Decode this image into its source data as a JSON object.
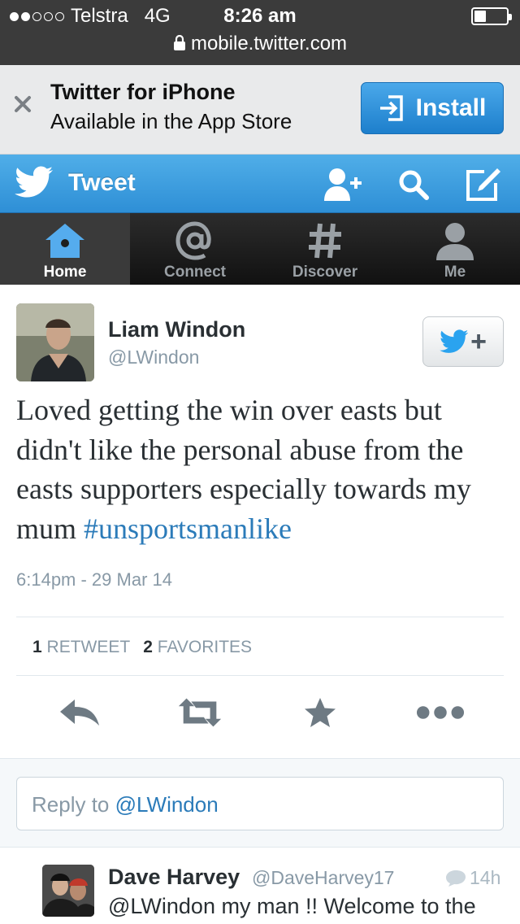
{
  "status_bar": {
    "carrier": "Telstra",
    "network": "4G",
    "time": "8:26 am",
    "signal_bars": 2,
    "url": "mobile.twitter.com"
  },
  "app_banner": {
    "title": "Twitter for iPhone",
    "subtitle": "Available in the App Store",
    "install_label": "Install"
  },
  "header": {
    "title": "Tweet",
    "icons": [
      "add-user-icon",
      "search-icon",
      "compose-icon"
    ]
  },
  "tabs": [
    {
      "label": "Home",
      "icon": "home-icon",
      "active": true
    },
    {
      "label": "Connect",
      "icon": "at-icon",
      "active": false
    },
    {
      "label": "Discover",
      "icon": "hashtag-icon",
      "active": false
    },
    {
      "label": "Me",
      "icon": "person-icon",
      "active": false
    }
  ],
  "tweet": {
    "author_name": "Liam Windon",
    "author_handle": "@LWindon",
    "text": "Loved getting the win over easts but didn't like the personal abuse from the easts supporters especially towards my mum ",
    "hashtag": "#unsportsmanlike",
    "timestamp": "6:14pm - 29 Mar 14",
    "retweet_count": "1",
    "retweet_label": "RETWEET",
    "favorite_count": "2",
    "favorite_label": "FAVORITES"
  },
  "reply_box": {
    "prefix": "Reply to ",
    "mention": "@LWindon"
  },
  "reply_tweet": {
    "author_name": "Dave Harvey",
    "author_handle": "@DaveHarvey17",
    "time": "14h",
    "text": "@LWindon my man !! Welcome to the"
  },
  "colors": {
    "twitter_blue": "#2b7bb9",
    "header_blue": "#3d9de0",
    "status_bar": "#3b3b3b"
  }
}
